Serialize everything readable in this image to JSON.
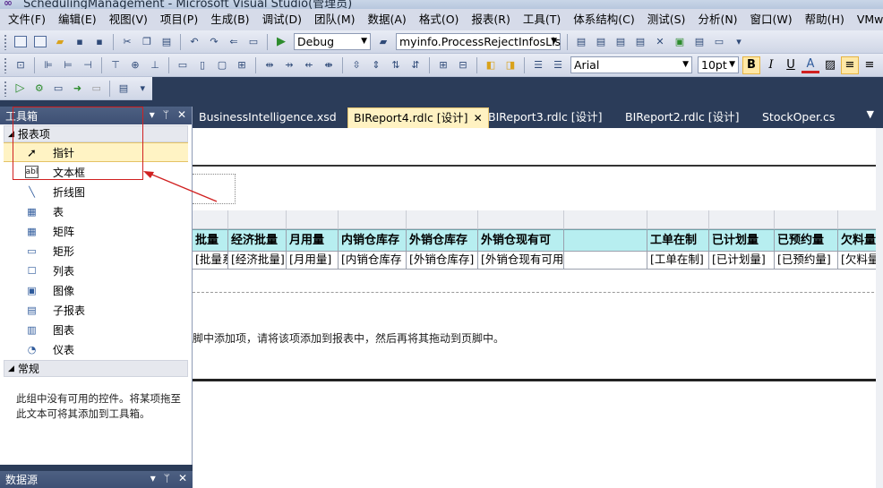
{
  "window": {
    "title": "SchedulingManagement - Microsoft Visual Studio(管理员)"
  },
  "menu": [
    "文件(F)",
    "编辑(E)",
    "视图(V)",
    "项目(P)",
    "生成(B)",
    "调试(D)",
    "团队(M)",
    "数据(A)",
    "格式(O)",
    "报表(R)",
    "工具(T)",
    "体系结构(C)",
    "测试(S)",
    "分析(N)",
    "窗口(W)",
    "帮助(H)",
    "VMware"
  ],
  "toolbar": {
    "config": "Debug",
    "startup_item": "myinfo.ProcessRejectInfosLis",
    "font_family": "Arial",
    "font_size": "10pt",
    "bold": "B",
    "italic": "I",
    "underline": "U",
    "font_color": "A"
  },
  "toolbox": {
    "title": "工具箱",
    "groups": [
      {
        "label": "报表项",
        "items": [
          {
            "label": "指针",
            "icon": "pointer-icon",
            "glyph": "➚"
          },
          {
            "label": "文本框",
            "icon": "textbox-icon",
            "glyph": "abl"
          },
          {
            "label": "折线图",
            "icon": "line-icon",
            "glyph": "╲"
          },
          {
            "label": "表",
            "icon": "table-icon",
            "glyph": "▦"
          },
          {
            "label": "矩阵",
            "icon": "matrix-icon",
            "glyph": "▦"
          },
          {
            "label": "矩形",
            "icon": "rectangle-icon",
            "glyph": "▭"
          },
          {
            "label": "列表",
            "icon": "list-icon",
            "glyph": "☐"
          },
          {
            "label": "图像",
            "icon": "image-icon",
            "glyph": "▣"
          },
          {
            "label": "子报表",
            "icon": "subreport-icon",
            "glyph": "▤"
          },
          {
            "label": "图表",
            "icon": "chart-icon",
            "glyph": "▥"
          },
          {
            "label": "仪表",
            "icon": "gauge-icon",
            "glyph": "◔"
          }
        ]
      },
      {
        "label": "常规",
        "empty_message": "此组中没有可用的控件。将某项拖至此文本可将其添加到工具箱。"
      }
    ]
  },
  "datasource_panel": {
    "title": "数据源"
  },
  "tabs": [
    {
      "label": "BusinessIntelligence.xsd",
      "active": false
    },
    {
      "label": "BIReport4.rdlc [设计]",
      "active": true
    },
    {
      "label": "BIReport3.rdlc [设计]",
      "active": false
    },
    {
      "label": "BIReport2.rdlc [设计]",
      "active": false
    },
    {
      "label": "StockOper.cs",
      "active": false
    }
  ],
  "report": {
    "headers": [
      "批量",
      "经济批量",
      "月用量",
      "内销仓库存",
      "外销仓库存",
      "外销仓现有可",
      "",
      "工单在制",
      "已计划量",
      "已预约量",
      "欠料量"
    ],
    "fields": [
      "[批量系",
      "[经济批量]",
      "[月用量]",
      "[内销仓库存",
      "[外销仓库存]",
      "[外销仓现有可用",
      "",
      "[工单在制]",
      "[已计划量]",
      "[已预约量]",
      "[欠料量"
    ],
    "footer_hint": "脚中添加项，请将该项添加到报表中，然后再将其拖动到页脚中。"
  },
  "colors": {
    "header_fill": "#b7eef0",
    "selection": "#fff3c4",
    "annotation": "#d02020"
  }
}
